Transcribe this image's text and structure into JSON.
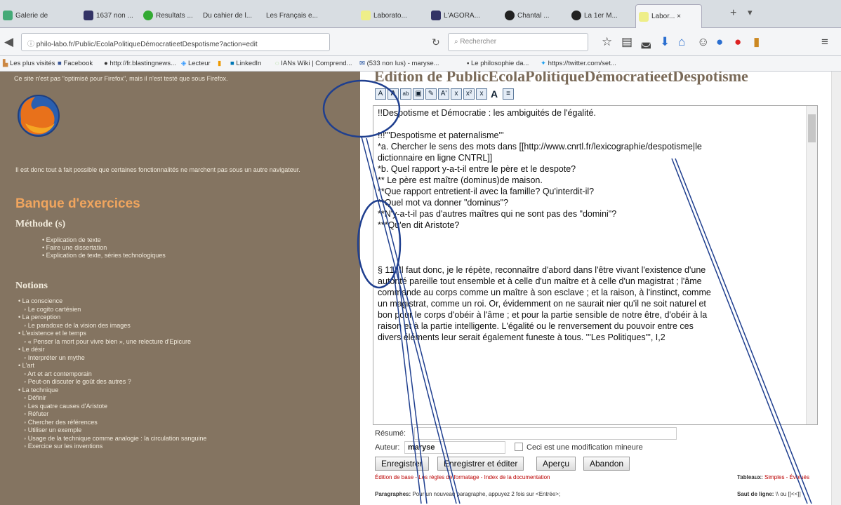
{
  "tabs": [
    {
      "label": "Galerie de ...",
      "color": "#4a7"
    },
    {
      "label": "1637 non ...",
      "color": "#336"
    },
    {
      "label": "Resultats ...",
      "color": "#3a3"
    },
    {
      "label": "Du cahier de l...",
      "color": "#ccc"
    },
    {
      "label": "Les Français e...",
      "color": "#ccc"
    },
    {
      "label": "Laborato...",
      "color": "#ee8"
    },
    {
      "label": "L'AGORA...",
      "color": "#336"
    },
    {
      "label": "Chantal ...",
      "color": "#222"
    },
    {
      "label": "La 1er M...",
      "color": "#222"
    },
    {
      "label": "Labor... ×",
      "color": "#ee8"
    }
  ],
  "nav": {
    "url": "philo-labo.fr/Public/EcolaPolitiqueDémocratieetDespotisme?action=edit",
    "search_placeholder": "Rechercher"
  },
  "bookmarks": [
    "Les plus visités",
    "Facebook",
    "http://fr.blastingnews...",
    "Lecteur",
    "LinkedIn",
    "IANs Wiki | Comprend...",
    "(533 non lus) - maryse...",
    "Le philosophie da...",
    "https://twitter.com/set..."
  ],
  "left": {
    "notice": "Ce site n'est pas \"optimisé pour Firefox\", mais il n'est testé que sous Firefox.",
    "warning": "Il est donc tout à fait possible que certaines fonctionnalités ne marchent pas sous un autre navigateur.",
    "bank_title": "Banque d'exercices",
    "method_title": "Méthode (s)",
    "methods": [
      "Explication de texte",
      "Faire une dissertation",
      "Explication de texte, séries technologiques"
    ],
    "notions_title": "Notions",
    "notions": [
      {
        "text": "• La conscience",
        "sub": false
      },
      {
        "text": "◦ Le cogito cartésien",
        "sub": true
      },
      {
        "text": "• La perception",
        "sub": false
      },
      {
        "text": "◦ Le paradoxe de la vision des images",
        "sub": true
      },
      {
        "text": "• L'existence et le temps",
        "sub": false
      },
      {
        "text": "◦ « Penser la mort pour vivre bien », une relecture d'Epicure",
        "sub": true
      },
      {
        "text": "• Le désir",
        "sub": false
      },
      {
        "text": "◦ Interpréter un mythe",
        "sub": true
      },
      {
        "text": "• L'art",
        "sub": false
      },
      {
        "text": "◦ Art et art contemporain",
        "sub": true
      },
      {
        "text": "◦ Peut-on discuter le goût des autres ?",
        "sub": true
      },
      {
        "text": "• La technique",
        "sub": false
      },
      {
        "text": "◦ Définir",
        "sub": true
      },
      {
        "text": "◦ Les quatre causes d'Aristote",
        "sub": true
      },
      {
        "text": "◦ Réfuter",
        "sub": true
      },
      {
        "text": "◦ Chercher des références",
        "sub": true
      },
      {
        "text": "◦ Utiliser un exemple",
        "sub": true
      },
      {
        "text": "◦ Usage de la technique comme analogie : la circulation sanguine",
        "sub": true
      },
      {
        "text": "◦ Exercice sur les inventions",
        "sub": true
      }
    ]
  },
  "page_title": "Édition de PublicEcolaPolitiqueDémocratieetDespotisme",
  "toolbar": [
    "A",
    "A",
    "ab",
    "",
    "",
    "A'",
    "x",
    "x²",
    "x",
    "A",
    "≡"
  ],
  "editor_lines": [
    "!!Despotisme et Démocratie : les ambiguités de l'égalité.",
    "",
    "!!!'''Despotisme et paternalisme'''",
    "*a. Chercher le sens des mots dans [[http://www.cnrtl.fr/lexicographie/despotisme|le",
    "dictionnaire en ligne CNTRL]]",
    "*b. Quel rapport y-a-t-il entre le père et le despote?",
    "** Le père est maître (dominus)de maison.",
    "**Que rapport entretient-il avec la famille? Qu'interdit-il?",
    "**Quel mot va donner \"dominus\"?",
    "**N'y-a-t-il pas d'autres maîtres qui ne sont pas des \"domini\"?",
    "***Qu'en dit Aristote?",
    "",
    "",
    "",
    "§ 11. Il faut donc, je le répète, reconnaître d'abord dans l'être vivant l'existence d'une",
    "autorité pareille tout ensemble et à celle d'un maître et à celle d'un magistrat ; l'âme",
    "commande au corps comme un maître à son esclave ; et la raison, à l'instinct, comme",
    "un magistrat, comme un roi. Or, évidemment on ne saurait nier qu'il ne soit naturel et",
    "bon pour le corps d'obéir à l'âme ; et pour la partie sensible de notre être, d'obéir à la",
    "raison et à la partie intelligente. L'égalité ou le renversement du pouvoir entre ces",
    "divers éléments leur serait également funeste à tous. '''Les Politiques''', I,2"
  ],
  "form": {
    "summary_label": "Résumé:",
    "author_label": "Auteur:",
    "author_value": "maryse",
    "minor_label": "Ceci est une modification mineure",
    "save": "Enregistrer",
    "save_edit": "Enregistrer et éditer",
    "preview": "Aperçu",
    "cancel": "Abandon",
    "help_line": "Édition de base - Les règles de formatage - Index de la documentation",
    "tables_label": "Tableaux:",
    "tables_value": "Simples - Évolués",
    "para_label": "Paragraphes:",
    "para_text": "Pour un nouveau paragraphe, appuyez 2 fois sur <Entrée>;",
    "linebreak_label": "Saut de ligne:",
    "linebreak_text": "\\\\ ou [[<<]]"
  },
  "colors": {
    "sidebar_bg": "#847461",
    "section_title": "#f0a55e",
    "annotation": "#1f3f8f"
  }
}
